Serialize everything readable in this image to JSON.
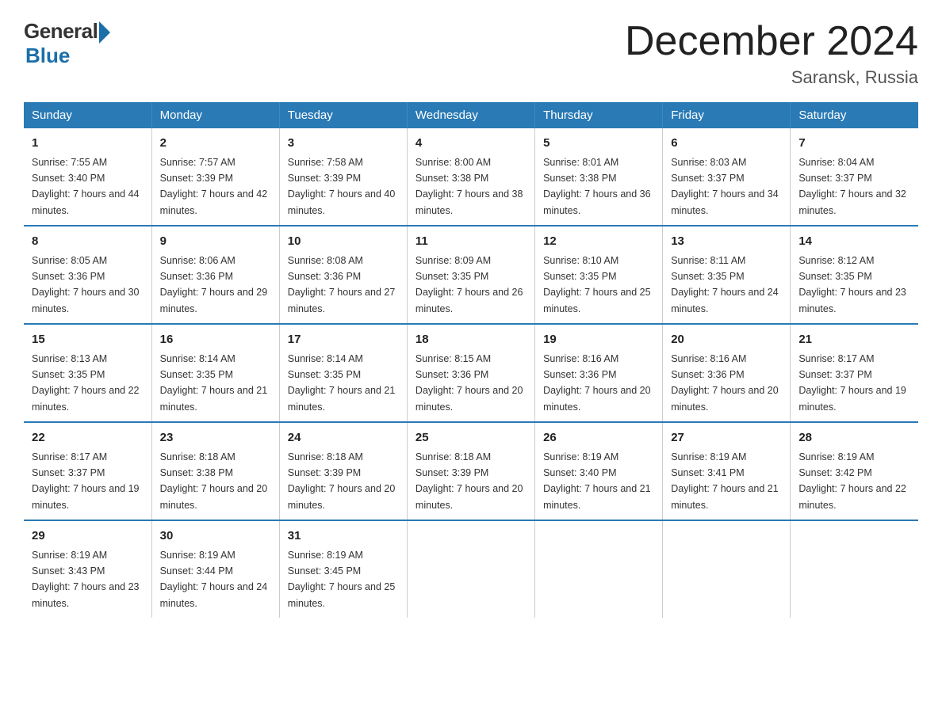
{
  "logo": {
    "general": "General",
    "blue": "Blue"
  },
  "title": "December 2024",
  "subtitle": "Saransk, Russia",
  "days_of_week": [
    "Sunday",
    "Monday",
    "Tuesday",
    "Wednesday",
    "Thursday",
    "Friday",
    "Saturday"
  ],
  "weeks": [
    [
      {
        "day": "1",
        "sunrise": "7:55 AM",
        "sunset": "3:40 PM",
        "daylight": "7 hours and 44 minutes."
      },
      {
        "day": "2",
        "sunrise": "7:57 AM",
        "sunset": "3:39 PM",
        "daylight": "7 hours and 42 minutes."
      },
      {
        "day": "3",
        "sunrise": "7:58 AM",
        "sunset": "3:39 PM",
        "daylight": "7 hours and 40 minutes."
      },
      {
        "day": "4",
        "sunrise": "8:00 AM",
        "sunset": "3:38 PM",
        "daylight": "7 hours and 38 minutes."
      },
      {
        "day": "5",
        "sunrise": "8:01 AM",
        "sunset": "3:38 PM",
        "daylight": "7 hours and 36 minutes."
      },
      {
        "day": "6",
        "sunrise": "8:03 AM",
        "sunset": "3:37 PM",
        "daylight": "7 hours and 34 minutes."
      },
      {
        "day": "7",
        "sunrise": "8:04 AM",
        "sunset": "3:37 PM",
        "daylight": "7 hours and 32 minutes."
      }
    ],
    [
      {
        "day": "8",
        "sunrise": "8:05 AM",
        "sunset": "3:36 PM",
        "daylight": "7 hours and 30 minutes."
      },
      {
        "day": "9",
        "sunrise": "8:06 AM",
        "sunset": "3:36 PM",
        "daylight": "7 hours and 29 minutes."
      },
      {
        "day": "10",
        "sunrise": "8:08 AM",
        "sunset": "3:36 PM",
        "daylight": "7 hours and 27 minutes."
      },
      {
        "day": "11",
        "sunrise": "8:09 AM",
        "sunset": "3:35 PM",
        "daylight": "7 hours and 26 minutes."
      },
      {
        "day": "12",
        "sunrise": "8:10 AM",
        "sunset": "3:35 PM",
        "daylight": "7 hours and 25 minutes."
      },
      {
        "day": "13",
        "sunrise": "8:11 AM",
        "sunset": "3:35 PM",
        "daylight": "7 hours and 24 minutes."
      },
      {
        "day": "14",
        "sunrise": "8:12 AM",
        "sunset": "3:35 PM",
        "daylight": "7 hours and 23 minutes."
      }
    ],
    [
      {
        "day": "15",
        "sunrise": "8:13 AM",
        "sunset": "3:35 PM",
        "daylight": "7 hours and 22 minutes."
      },
      {
        "day": "16",
        "sunrise": "8:14 AM",
        "sunset": "3:35 PM",
        "daylight": "7 hours and 21 minutes."
      },
      {
        "day": "17",
        "sunrise": "8:14 AM",
        "sunset": "3:35 PM",
        "daylight": "7 hours and 21 minutes."
      },
      {
        "day": "18",
        "sunrise": "8:15 AM",
        "sunset": "3:36 PM",
        "daylight": "7 hours and 20 minutes."
      },
      {
        "day": "19",
        "sunrise": "8:16 AM",
        "sunset": "3:36 PM",
        "daylight": "7 hours and 20 minutes."
      },
      {
        "day": "20",
        "sunrise": "8:16 AM",
        "sunset": "3:36 PM",
        "daylight": "7 hours and 20 minutes."
      },
      {
        "day": "21",
        "sunrise": "8:17 AM",
        "sunset": "3:37 PM",
        "daylight": "7 hours and 19 minutes."
      }
    ],
    [
      {
        "day": "22",
        "sunrise": "8:17 AM",
        "sunset": "3:37 PM",
        "daylight": "7 hours and 19 minutes."
      },
      {
        "day": "23",
        "sunrise": "8:18 AM",
        "sunset": "3:38 PM",
        "daylight": "7 hours and 20 minutes."
      },
      {
        "day": "24",
        "sunrise": "8:18 AM",
        "sunset": "3:39 PM",
        "daylight": "7 hours and 20 minutes."
      },
      {
        "day": "25",
        "sunrise": "8:18 AM",
        "sunset": "3:39 PM",
        "daylight": "7 hours and 20 minutes."
      },
      {
        "day": "26",
        "sunrise": "8:19 AM",
        "sunset": "3:40 PM",
        "daylight": "7 hours and 21 minutes."
      },
      {
        "day": "27",
        "sunrise": "8:19 AM",
        "sunset": "3:41 PM",
        "daylight": "7 hours and 21 minutes."
      },
      {
        "day": "28",
        "sunrise": "8:19 AM",
        "sunset": "3:42 PM",
        "daylight": "7 hours and 22 minutes."
      }
    ],
    [
      {
        "day": "29",
        "sunrise": "8:19 AM",
        "sunset": "3:43 PM",
        "daylight": "7 hours and 23 minutes."
      },
      {
        "day": "30",
        "sunrise": "8:19 AM",
        "sunset": "3:44 PM",
        "daylight": "7 hours and 24 minutes."
      },
      {
        "day": "31",
        "sunrise": "8:19 AM",
        "sunset": "3:45 PM",
        "daylight": "7 hours and 25 minutes."
      },
      null,
      null,
      null,
      null
    ]
  ]
}
